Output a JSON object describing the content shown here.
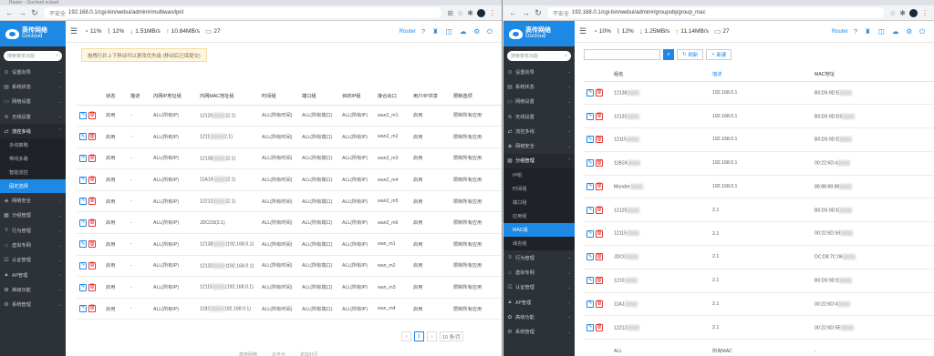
{
  "win1": {
    "tab_title": "Router - Gocloud ocloud",
    "url_prefix": "不安全",
    "url": "192.168.0.1/cgi-bin/webui/admin#/multiwan/ipri/",
    "brand_cn": "高传网络",
    "brand_en": "Gocloud",
    "search_placeholder": "搜索菜单功能",
    "menu": [
      {
        "icon": "⊙",
        "label": "设置向导"
      },
      {
        "icon": "▤",
        "label": "系统状态"
      },
      {
        "icon": "▭",
        "label": "网络设置"
      },
      {
        "icon": "≋",
        "label": "无线设置"
      },
      {
        "icon": "⇄",
        "label": "流控多线",
        "open": true
      }
    ],
    "submenu": [
      "多线策略",
      "带线多路",
      "智能流控",
      "固定选择"
    ],
    "submenu_active_index": 3,
    "menu_after": [
      {
        "icon": "◈",
        "label": "网络安全"
      },
      {
        "icon": "▦",
        "label": "分组管理"
      },
      {
        "icon": "≡",
        "label": "行为管理"
      },
      {
        "icon": "⌂",
        "label": "虚拟专网"
      },
      {
        "icon": "☑",
        "label": "认证管理"
      },
      {
        "icon": "▲",
        "label": "AP管理"
      },
      {
        "icon": "✿",
        "label": "高级功能"
      },
      {
        "icon": "⚙",
        "label": "系统管理"
      }
    ],
    "status": {
      "cpu": "11%",
      "mem": "12%",
      "down": "1.51MB/s",
      "up": "10.84MB/s",
      "users": "27"
    },
    "router_label": "Router",
    "notice": "拖拽行并上下移动可以更改优先级 (移动后已保提交)",
    "columns": [
      "状态",
      "描述",
      "内网IP地址组",
      "内网MAC地址组",
      "时间组",
      "端口组",
      "目的IP组",
      "接合出口",
      "用户/IP共享",
      "限制选项"
    ],
    "rows": [
      {
        "status": "启用",
        "desc": "-",
        "ipgroup": "ALL(所有IP)",
        "mac": "12125",
        "mac_tail": "(2.1)",
        "time": "ALL(所有时间)",
        "port": "ALL(所有端口)",
        "dst": "ALL(所有IP)",
        "wan": "wan2_m1",
        "share": "启用",
        "limit": "限制所有应用"
      },
      {
        "status": "启用",
        "desc": "-",
        "ipgroup": "ALL(所有IP)",
        "mac": "1211",
        "mac_tail": "(2.1)",
        "time": "ALL(所有时间)",
        "port": "ALL(所有端口)",
        "dst": "ALL(所有IP)",
        "wan": "wan2_m2",
        "share": "启用",
        "limit": "限制所有应用"
      },
      {
        "status": "启用",
        "desc": "-",
        "ipgroup": "ALL(所有IP)",
        "mac": "12108",
        "mac_tail": "(2.1)",
        "time": "ALL(所有时间)",
        "port": "ALL(所有端口)",
        "dst": "ALL(所有IP)",
        "wan": "wan2_m3",
        "share": "启用",
        "limit": "限制所有应用"
      },
      {
        "status": "启用",
        "desc": "-",
        "ipgroup": "ALL(所有IP)",
        "mac": "11A14",
        "mac_tail": "(2.1)",
        "time": "ALL(所有时间)",
        "port": "ALL(所有端口)",
        "dst": "ALL(所有IP)",
        "wan": "wan2_m4",
        "share": "启用",
        "limit": "限制所有应用"
      },
      {
        "status": "启用",
        "desc": "-",
        "ipgroup": "ALL(所有IP)",
        "mac": "12212",
        "mac_tail": "(2.1)",
        "time": "ALL(所有时间)",
        "port": "ALL(所有端口)",
        "dst": "ALL(所有IP)",
        "wan": "wan2_m5",
        "share": "启用",
        "limit": "限制所有应用"
      },
      {
        "status": "启用",
        "desc": "-",
        "ipgroup": "ALL(所有IP)",
        "mac": "JDCO3(2.1)",
        "mac_tail": "",
        "time": "ALL(所有时间)",
        "port": "ALL(所有端口)",
        "dst": "ALL(所有IP)",
        "wan": "wan2_m6",
        "share": "启用",
        "limit": "限制所有应用"
      },
      {
        "status": "启用",
        "desc": "-",
        "ipgroup": "ALL(所有IP)",
        "mac": "12138",
        "mac_tail": "(192.168.0.1)",
        "time": "ALL(所有时间)",
        "port": "ALL(所有端口)",
        "dst": "ALL(所有IP)",
        "wan": "wan_m1",
        "share": "启用",
        "limit": "限制所有应用"
      },
      {
        "status": "启用",
        "desc": "-",
        "ipgroup": "ALL(所有IP)",
        "mac": "12132",
        "mac_tail": "(192.168.0.1)",
        "time": "ALL(所有时间)",
        "port": "ALL(所有端口)",
        "dst": "ALL(所有IP)",
        "wan": "wan_m2",
        "share": "启用",
        "limit": "限制所有应用"
      },
      {
        "status": "启用",
        "desc": "-",
        "ipgroup": "ALL(所有IP)",
        "mac": "12115",
        "mac_tail": "(192.168.0.1)",
        "time": "ALL(所有时间)",
        "port": "ALL(所有端口)",
        "dst": "ALL(所有IP)",
        "wan": "wan_m3",
        "share": "启用",
        "limit": "限制所有应用"
      },
      {
        "status": "启用",
        "desc": "-",
        "ipgroup": "ALL(所有IP)",
        "mac": "1182",
        "mac_tail": "(192.168.0.1)",
        "time": "ALL(所有时间)",
        "port": "ALL(所有端口)",
        "dst": "ALL(所有IP)",
        "wan": "wan_m4",
        "share": "启用",
        "limit": "限制所有应用"
      }
    ],
    "pager": {
      "prev": "‹",
      "page": "1",
      "next": "›",
      "size": "10 条/页"
    },
    "footer": [
      "高传网络",
      "云平台",
      "论坛社区"
    ]
  },
  "win2": {
    "url_prefix": "不安全",
    "url": "192.168.0.1/cgi-bin/webui/admin#/groupobj/group_mac",
    "brand_cn": "高传网络",
    "brand_en": "Gocloud",
    "search_placeholder": "搜索菜单功能",
    "menu": [
      {
        "icon": "⊙",
        "label": "设置向导"
      },
      {
        "icon": "▤",
        "label": "系统状态"
      },
      {
        "icon": "▭",
        "label": "网络设置"
      },
      {
        "icon": "≋",
        "label": "无线设置"
      },
      {
        "icon": "⇄",
        "label": "流控多线"
      },
      {
        "icon": "◈",
        "label": "网络安全"
      },
      {
        "icon": "▦",
        "label": "分组管理",
        "open": true
      }
    ],
    "submenu": [
      "IP组",
      "时间组",
      "端口组",
      "应用组",
      "MAC组",
      "域名组"
    ],
    "submenu_active_index": 4,
    "menu_after": [
      {
        "icon": "≡",
        "label": "行为管理"
      },
      {
        "icon": "⌂",
        "label": "虚拟专网"
      },
      {
        "icon": "☑",
        "label": "认证管理"
      },
      {
        "icon": "▲",
        "label": "AP管理"
      },
      {
        "icon": "✿",
        "label": "高级功能"
      },
      {
        "icon": "⚙",
        "label": "系统管理"
      }
    ],
    "status": {
      "cpu": "10%",
      "mem": "12%",
      "down": "1.25MB/s",
      "up": "11.14MB/s",
      "users": "27"
    },
    "router_label": "Router",
    "refresh_label": "刷新",
    "new_label": "新建",
    "columns": [
      "组名",
      "描述",
      "MAC地址"
    ],
    "rows": [
      {
        "name": "12138",
        "desc": "192.168.0.1",
        "mac": "B0:D5:9D:E"
      },
      {
        "name": "12132",
        "desc": "192.168.0.1",
        "mac": "B0:D5:9D:E6"
      },
      {
        "name": "12115",
        "desc": "192.168.0.1",
        "mac": "B0:D5:9D:E"
      },
      {
        "name": "11B24",
        "desc": "192.168.0.1",
        "mac": "00:22:6D:4"
      },
      {
        "name": "Monder",
        "desc": "192.168.0.1",
        "mac": "88:88:88:88"
      },
      {
        "name": "12125",
        "desc": "2.1",
        "mac": "B0:D5:9D:E"
      },
      {
        "name": "12115",
        "desc": "2.1",
        "mac": "00:22:6D:59"
      },
      {
        "name": "JDC0",
        "desc": "2.1",
        "mac": "DC:D8:7C:06"
      },
      {
        "name": "1210",
        "desc": "2.1",
        "mac": "B0:D5:9D:E"
      },
      {
        "name": "11A1",
        "desc": "2.1",
        "mac": "00:22:6D:4"
      },
      {
        "name": "12212",
        "desc": "2.1",
        "mac": "00:22:6D:5E"
      },
      {
        "name": "ALL",
        "desc": "所有MAC",
        "mac": "-",
        "no_ops": true
      }
    ]
  },
  "colors": {
    "accent": "#1e88e5",
    "sidebar": "#2d3138",
    "danger": "#e53935"
  }
}
